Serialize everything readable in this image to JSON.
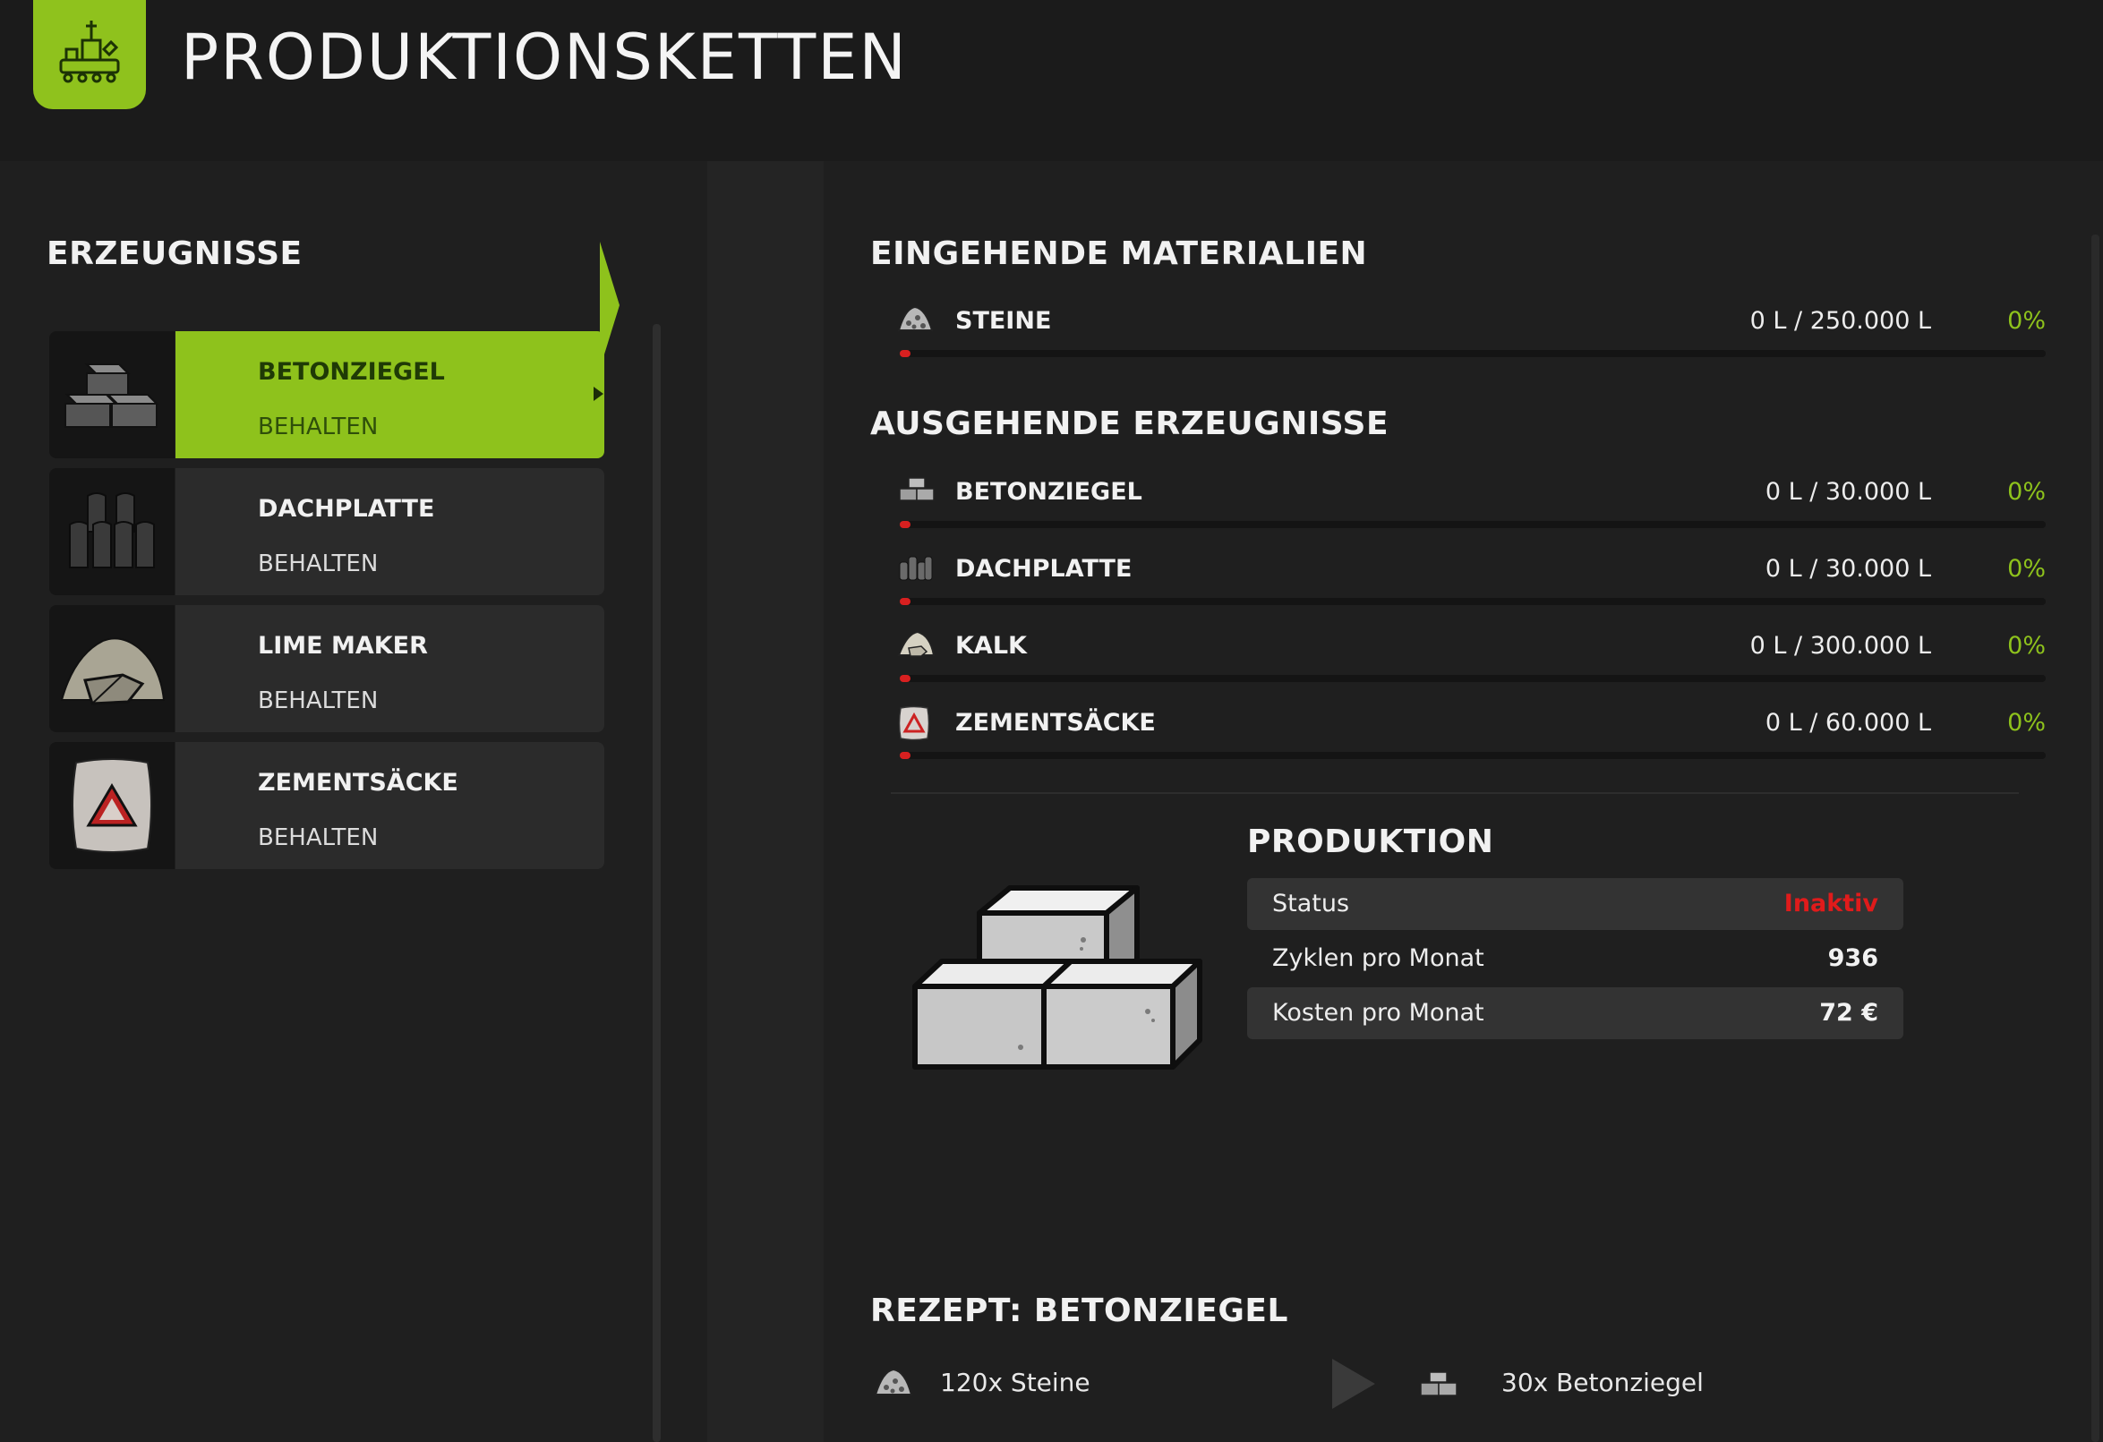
{
  "header": {
    "title": "PRODUKTIONSKETTEN",
    "icon": "production-chain-icon",
    "accent_color": "#8fc21d"
  },
  "products": {
    "title": "ERZEUGNISSE",
    "items": [
      {
        "name": "BETONZIEGEL",
        "mode": "BEHALTEN",
        "icon": "concrete-bricks-icon",
        "selected": true
      },
      {
        "name": "DACHPLATTE",
        "mode": "BEHALTEN",
        "icon": "roof-tiles-icon",
        "selected": false
      },
      {
        "name": "LIME MAKER",
        "mode": "BEHALTEN",
        "icon": "lime-pile-icon",
        "selected": false
      },
      {
        "name": "ZEMENTSÄCKE",
        "mode": "BEHALTEN",
        "icon": "cement-sack-icon",
        "selected": false
      }
    ]
  },
  "incoming": {
    "title": "EINGEHENDE MATERIALIEN",
    "items": [
      {
        "name": "STEINE",
        "amount": "0 L / 250.000 L",
        "percent": "0%",
        "fill": 0,
        "icon": "stones-icon"
      }
    ]
  },
  "outgoing": {
    "title": "AUSGEHENDE ERZEUGNISSE",
    "items": [
      {
        "name": "BETONZIEGEL",
        "amount": "0 L / 30.000 L",
        "percent": "0%",
        "fill": 0,
        "icon": "concrete-bricks-icon"
      },
      {
        "name": "DACHPLATTE",
        "amount": "0 L / 30.000 L",
        "percent": "0%",
        "fill": 0,
        "icon": "roof-tiles-icon"
      },
      {
        "name": "KALK",
        "amount": "0 L / 300.000 L",
        "percent": "0%",
        "fill": 0,
        "icon": "lime-pile-icon"
      },
      {
        "name": "ZEMENTSÄCKE",
        "amount": "0 L / 60.000 L",
        "percent": "0%",
        "fill": 0,
        "icon": "cement-sack-icon"
      }
    ]
  },
  "production": {
    "title": "PRODUKTION",
    "status_label": "Status",
    "status_value": "Inaktiv",
    "cycles_label": "Zyklen pro Monat",
    "cycles_value": "936",
    "cost_label": "Kosten pro Monat",
    "cost_value": "72 €",
    "status_color": "#e01b1b"
  },
  "recipe": {
    "title": "REZEPT: BETONZIEGEL",
    "input": "120x Steine",
    "output": "30x Betonziegel",
    "input_icon": "stones-icon",
    "output_icon": "concrete-bricks-icon"
  }
}
